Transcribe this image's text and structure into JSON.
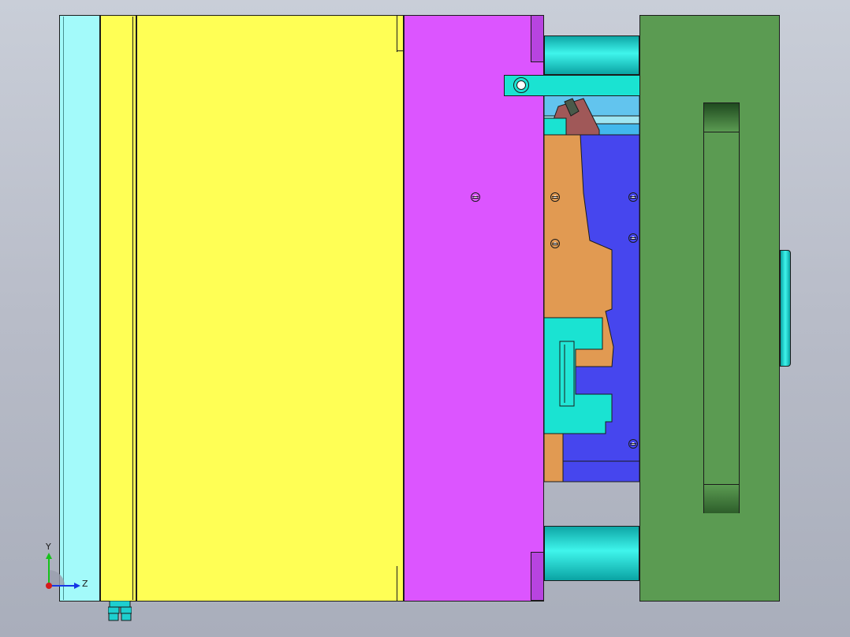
{
  "view": {
    "background_top": "#c9ced8",
    "background_bottom": "#a9aebb",
    "orientation": {
      "y_axis_label": "Y",
      "z_axis_label": "Z",
      "y_color": "#16c21a",
      "z_color": "#1637e6",
      "x_color": "#d61a1a"
    }
  },
  "parts": {
    "left_plate": {
      "color": "#a3fafa"
    },
    "yellow_plate": {
      "color": "#ffff55"
    },
    "magenta_plate": {
      "color": "#dc55ff"
    },
    "green_plate": {
      "color": "#5b9b52"
    },
    "cavity_orange": {
      "color": "#e19a52"
    },
    "core_blue": {
      "color": "#4646ee"
    },
    "cyan_parts": {
      "color": "#1ae3d2"
    },
    "guide_pillars": {
      "color": "#10d0c8"
    },
    "hose_connector": {
      "color": "#1ecfcf"
    }
  }
}
